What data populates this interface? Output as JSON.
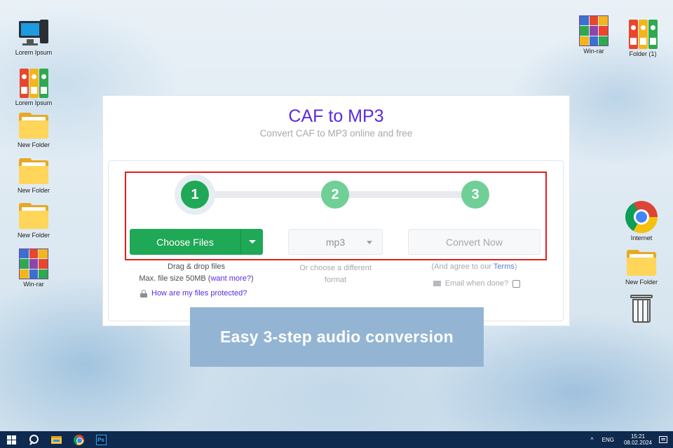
{
  "desktop": {
    "left_icons": [
      {
        "label": "Lorem Ipsum",
        "icon": "computer-icon"
      },
      {
        "label": "Lorem Ipsum",
        "icon": "binders-icon"
      },
      {
        "label": "New Folder",
        "icon": "folder-icon"
      },
      {
        "label": "New Folder",
        "icon": "folder-icon"
      },
      {
        "label": "New Folder",
        "icon": "folder-icon"
      },
      {
        "label": "Win-rar",
        "icon": "winrar-icon"
      }
    ],
    "right_icons": [
      {
        "label": "Win-rar",
        "icon": "winrar-icon"
      },
      {
        "label": "Folder (1)",
        "icon": "binders-icon"
      },
      {
        "label": "Internet",
        "icon": "chrome-icon"
      },
      {
        "label": "New Folder",
        "icon": "folder-icon"
      },
      {
        "label": "",
        "icon": "recycle-bin-icon"
      }
    ]
  },
  "converter": {
    "title": "CAF to MP3",
    "subtitle": "Convert CAF to MP3 online and free",
    "steps": [
      "1",
      "2",
      "3"
    ],
    "choose_files_label": "Choose Files",
    "drag_drop_text": "Drag & drop files",
    "max_size_text": "Max. file size 50MB (",
    "want_more_link": "want more?",
    "max_size_close": ")",
    "protected_link": "How are my files protected?",
    "format_value": "mp3",
    "choose_format_text": "Or choose a different format",
    "convert_label": "Convert Now",
    "agree_prefix": "(And agree to our ",
    "terms_link": "Terms",
    "agree_suffix": ")",
    "email_label": "Email when done?",
    "colors": {
      "title": "#5b2ae0",
      "step_active": "#1fa855",
      "step_inactive": "#6fcf97",
      "highlight_border": "#e0201b"
    }
  },
  "banner": {
    "text": "Easy 3-step audio conversion"
  },
  "taskbar": {
    "apps": [
      "windows-start-icon",
      "search-icon",
      "file-explorer-icon",
      "chrome-icon",
      "photoshop-icon"
    ],
    "photoshop_text": "Ps",
    "tray": {
      "chevron": "^",
      "language": "ENG",
      "time": "15:21",
      "date": "08.02.2024"
    }
  }
}
